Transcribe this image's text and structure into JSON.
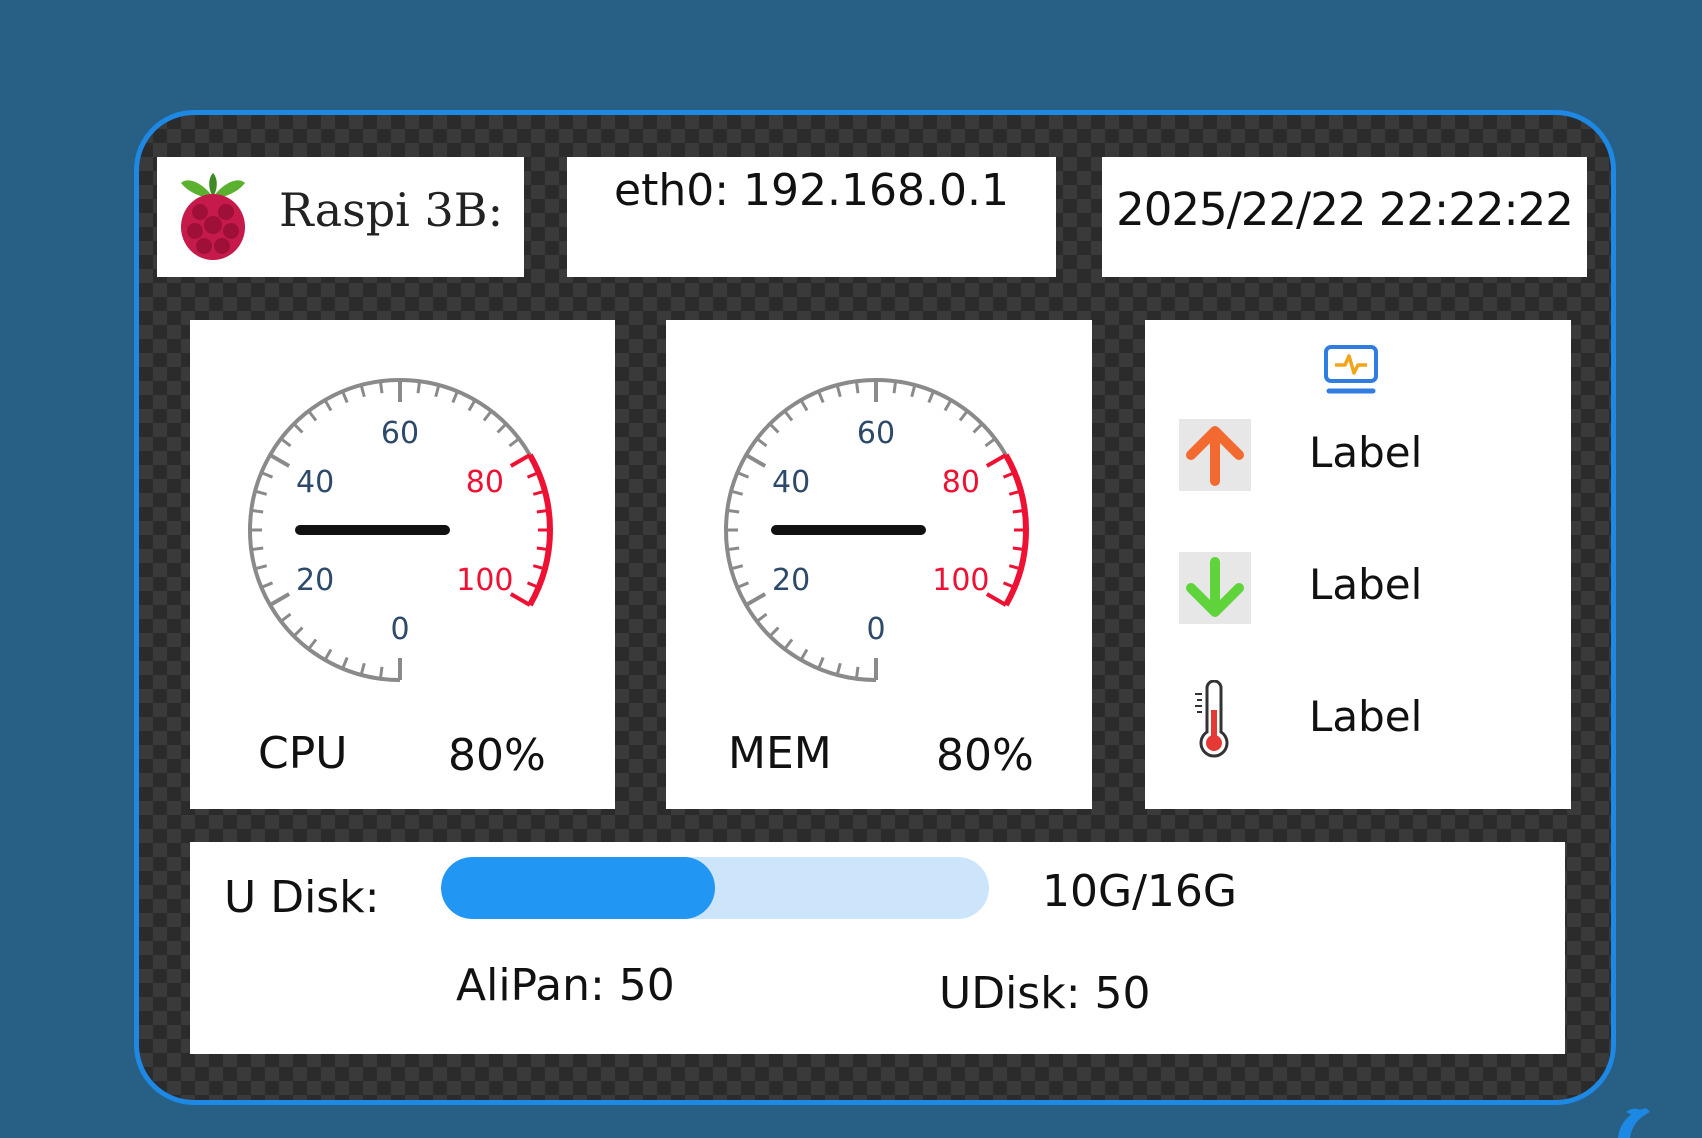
{
  "header": {
    "host_label": "Raspi 3B:",
    "ip_label": "eth0: 192.168.0.1",
    "datetime": "2025/22/22 22:22:22"
  },
  "gauges": {
    "cpu": {
      "name": "CPU",
      "value_text": "80%",
      "needle_value": 30
    },
    "mem": {
      "name": "MEM",
      "value_text": "80%",
      "needle_value": 30
    },
    "scale": {
      "min": 0,
      "max": 100,
      "tick_labels": [
        "0",
        "20",
        "40",
        "60",
        "80",
        "100"
      ],
      "red_from": 80,
      "normal_color": "#8a8a8a",
      "label_color": "#2d4a6b",
      "red_color": "#ee1133",
      "needle_color": "#111111"
    }
  },
  "network": {
    "monitor_icon": "monitor-activity-icon",
    "upload": {
      "icon": "arrow-up-icon",
      "label": "Label",
      "color": "#f26a30"
    },
    "download": {
      "icon": "arrow-down-icon",
      "label": "Label",
      "color": "#5fd33a"
    },
    "temperature": {
      "icon": "thermometer-icon",
      "label": "Label",
      "color": "#e53935"
    }
  },
  "disk": {
    "title": "U Disk:",
    "progress": 0.5,
    "size_text": "10G/16G",
    "alipan_label": "AliPan: 50",
    "udisk_label": "UDisk: 50",
    "bar_color": "#2196f3",
    "bar_track_color": "#cce5fb"
  },
  "colors": {
    "background": "#285f84",
    "frame_border": "#1e88e5"
  }
}
